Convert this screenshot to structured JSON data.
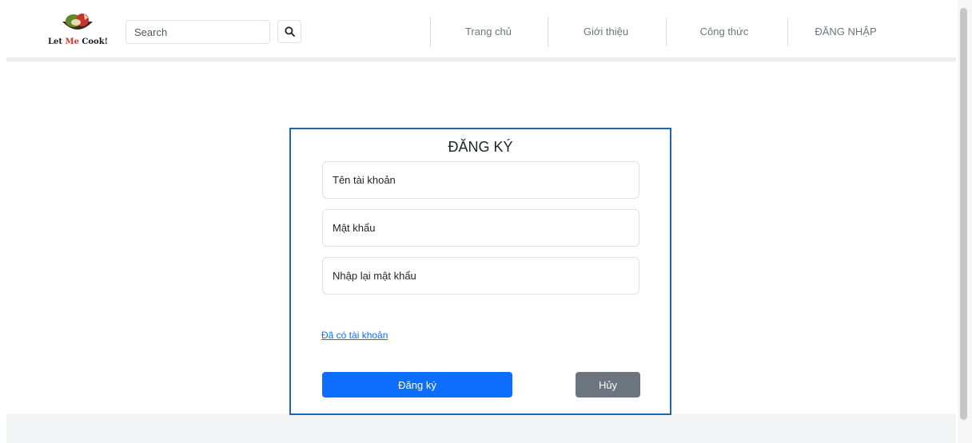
{
  "logo": {
    "text_prefix": "Let ",
    "text_me": "Me",
    "text_suffix": " Cook!"
  },
  "search": {
    "placeholder": "Search",
    "icon": "search-icon"
  },
  "nav": {
    "items": [
      {
        "label": "Trang chủ"
      },
      {
        "label": "Giới thiệu"
      },
      {
        "label": "Công thức"
      },
      {
        "label": "ĐĂNG NHẬP"
      }
    ]
  },
  "form": {
    "title": "ĐĂNG KÝ",
    "username_placeholder": "Tên tài khoản",
    "password_placeholder": "Mật khẩu",
    "confirm_placeholder": "Nhập lại mật khẩu",
    "have_account_link": "Đã có tài khoản",
    "register_label": "Đăng ký",
    "cancel_label": "Hủy"
  },
  "colors": {
    "primary": "#0d6efd",
    "secondary": "#6c757d",
    "card_border": "#2366a8",
    "logo_accent": "#d3322b"
  }
}
